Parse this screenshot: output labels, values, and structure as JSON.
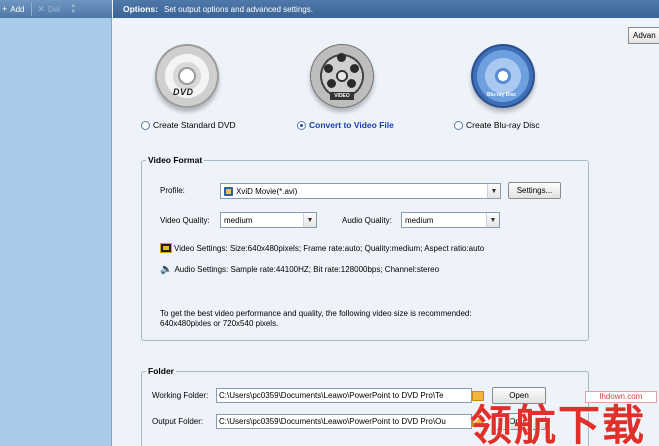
{
  "left_toolbar": {
    "add_label": "Add",
    "add_icon": "plus-icon",
    "del_label": "Del",
    "del_icon": "x-icon"
  },
  "header": {
    "title": "Options:",
    "description": "Set output options and advanced settings."
  },
  "advanced_button": "Advan",
  "output_modes": [
    {
      "label": "Create Standard DVD",
      "selected": false,
      "disc_text": "DVD"
    },
    {
      "label": "Convert to Video File",
      "selected": true,
      "disc_text": "VIDEO"
    },
    {
      "label": "Create Blu-ray Disc",
      "selected": false,
      "disc_text": "Blu-ray Disc"
    }
  ],
  "video_format": {
    "title": "Video Format",
    "profile_label": "Profile:",
    "profile_value": "XviD Movie(*.avi)",
    "settings_button": "Settings...",
    "video_quality_label": "Video Quality:",
    "video_quality_value": "medium",
    "audio_quality_label": "Audio Quality:",
    "audio_quality_value": "medium",
    "video_settings": "Video Settings: Size:640x480pixels; Frame rate:auto; Quality:medium; Aspect ratio:auto",
    "audio_settings": "Audio Settings: Sample rate:44100HZ; Bit rate:128000bps; Channel:stereo",
    "note_line1": "To get the best video performance and quality, the following video size is recommended:",
    "note_line2": "640x480pixles or 720x540 pixels."
  },
  "folder": {
    "title": "Folder",
    "working_label": "Working Folder:",
    "working_path": "C:\\Users\\pc0359\\Documents\\Leawo\\PowerPoint to DVD Pro\\Te",
    "output_label": "Output Folder:",
    "output_path": "C:\\Users\\pc0359\\Documents\\Leawo\\PowerPoint to DVD Pro\\Ou",
    "open_button": "Open"
  },
  "watermark": {
    "text": "领航下载",
    "site": "lhdown.com"
  },
  "colors": {
    "header_bg": "#3b6496",
    "left_panel_bg": "#a9cae8",
    "main_bg": "#eef3fa",
    "selected_text": "#1a3fb0",
    "watermark_red": "#e0302c"
  }
}
